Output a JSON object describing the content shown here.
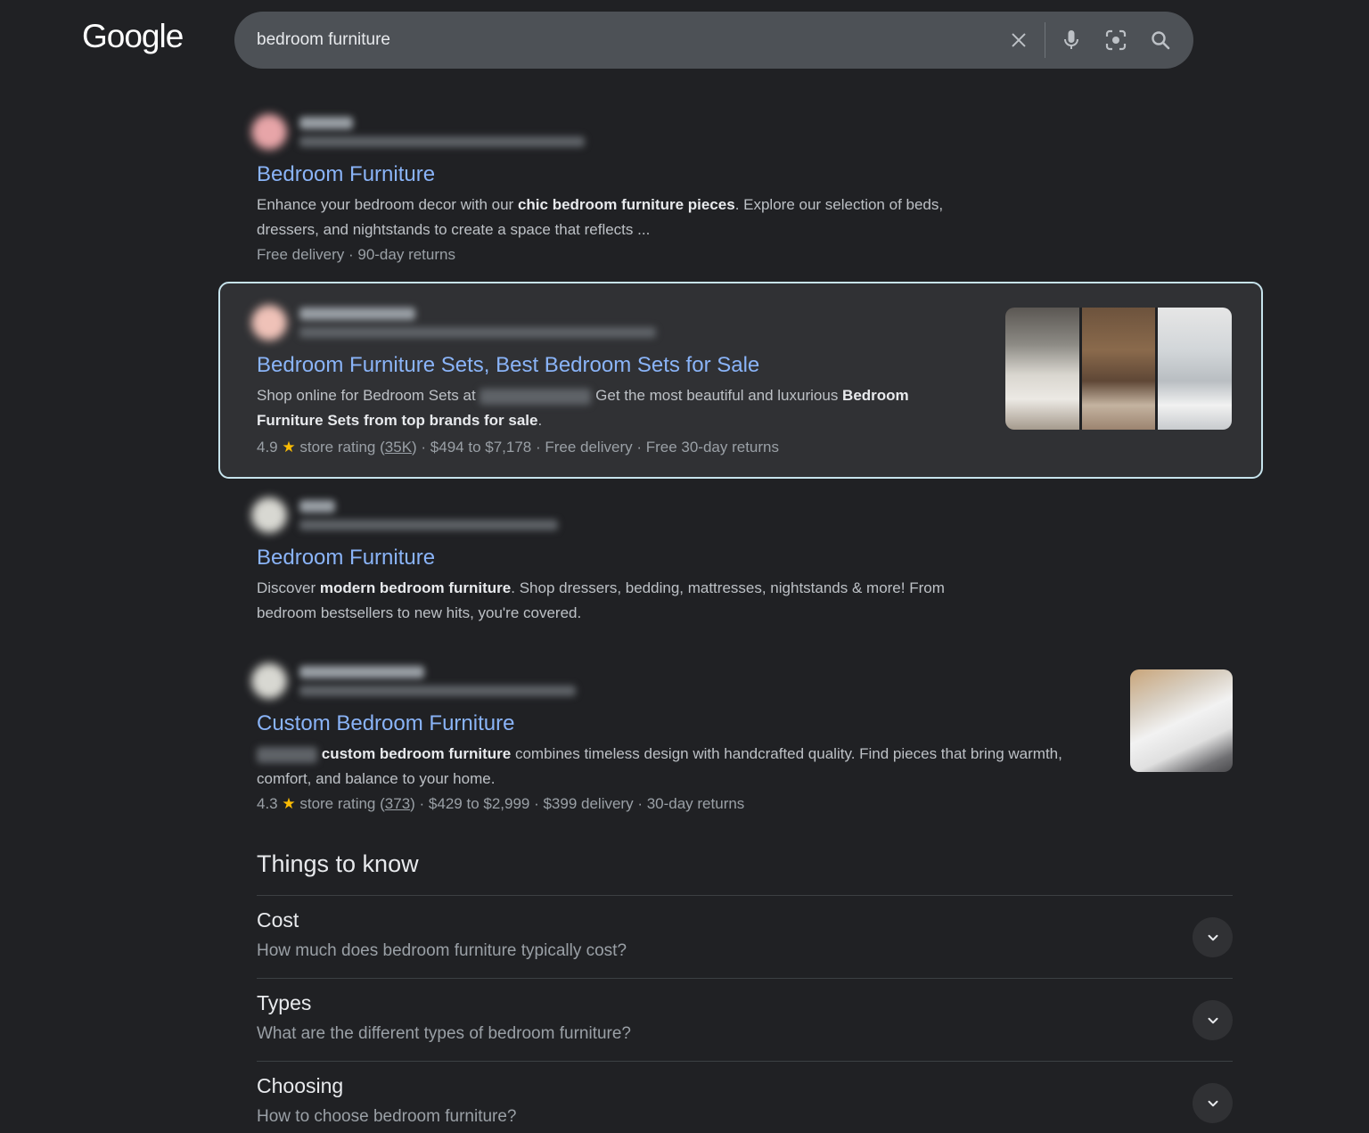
{
  "header": {
    "logo": "Google",
    "search": {
      "value": "bedroom furniture"
    }
  },
  "results": [
    {
      "title": "Bedroom Furniture",
      "snippet": {
        "t1": "Enhance your bedroom decor with our ",
        "b1": "chic bedroom furniture pieces",
        "t2": ". Explore our selection of beds, dressers, and nightstands to create a space that reflects ..."
      },
      "meta": "Free delivery · 90-day returns"
    },
    {
      "title": "Bedroom Furniture Sets, Best Bedroom Sets for Sale",
      "snippet": {
        "t1": "Shop online for Bedroom Sets at ",
        "t2": " Get the most beautiful and luxurious ",
        "b1": "Bedroom Furniture Sets from top brands for sale",
        "t3": "."
      },
      "meta": {
        "rating": "4.9",
        "star": "★",
        "label": " store rating (",
        "count": "35K",
        "rest": ") · $494 to $7,178 · Free delivery · Free 30-day returns"
      }
    },
    {
      "title": "Bedroom Furniture",
      "snippet": {
        "t1": "Discover ",
        "b1": "modern bedroom furniture",
        "t2": ". Shop dressers, bedding, mattresses, nightstands & more! From bedroom bestsellers to new hits, you're covered."
      }
    },
    {
      "title": "Custom Bedroom Furniture",
      "snippet": {
        "b1": "custom bedroom furniture",
        "t1": " combines timeless design with handcrafted quality. Find pieces that bring warmth, comfort, and balance to your home."
      },
      "meta": {
        "rating": "4.3",
        "star": "★",
        "label": " store rating (",
        "count": "373",
        "rest": ") · $429 to $2,999 · $399 delivery · 30-day returns"
      }
    }
  ],
  "things_to_know": {
    "title": "Things to know",
    "items": [
      {
        "label": "Cost",
        "question": "How much does bedroom furniture typically cost?"
      },
      {
        "label": "Types",
        "question": "What are the different types of bedroom furniture?"
      },
      {
        "label": "Choosing",
        "question": "How to choose bedroom furniture?"
      }
    ]
  }
}
